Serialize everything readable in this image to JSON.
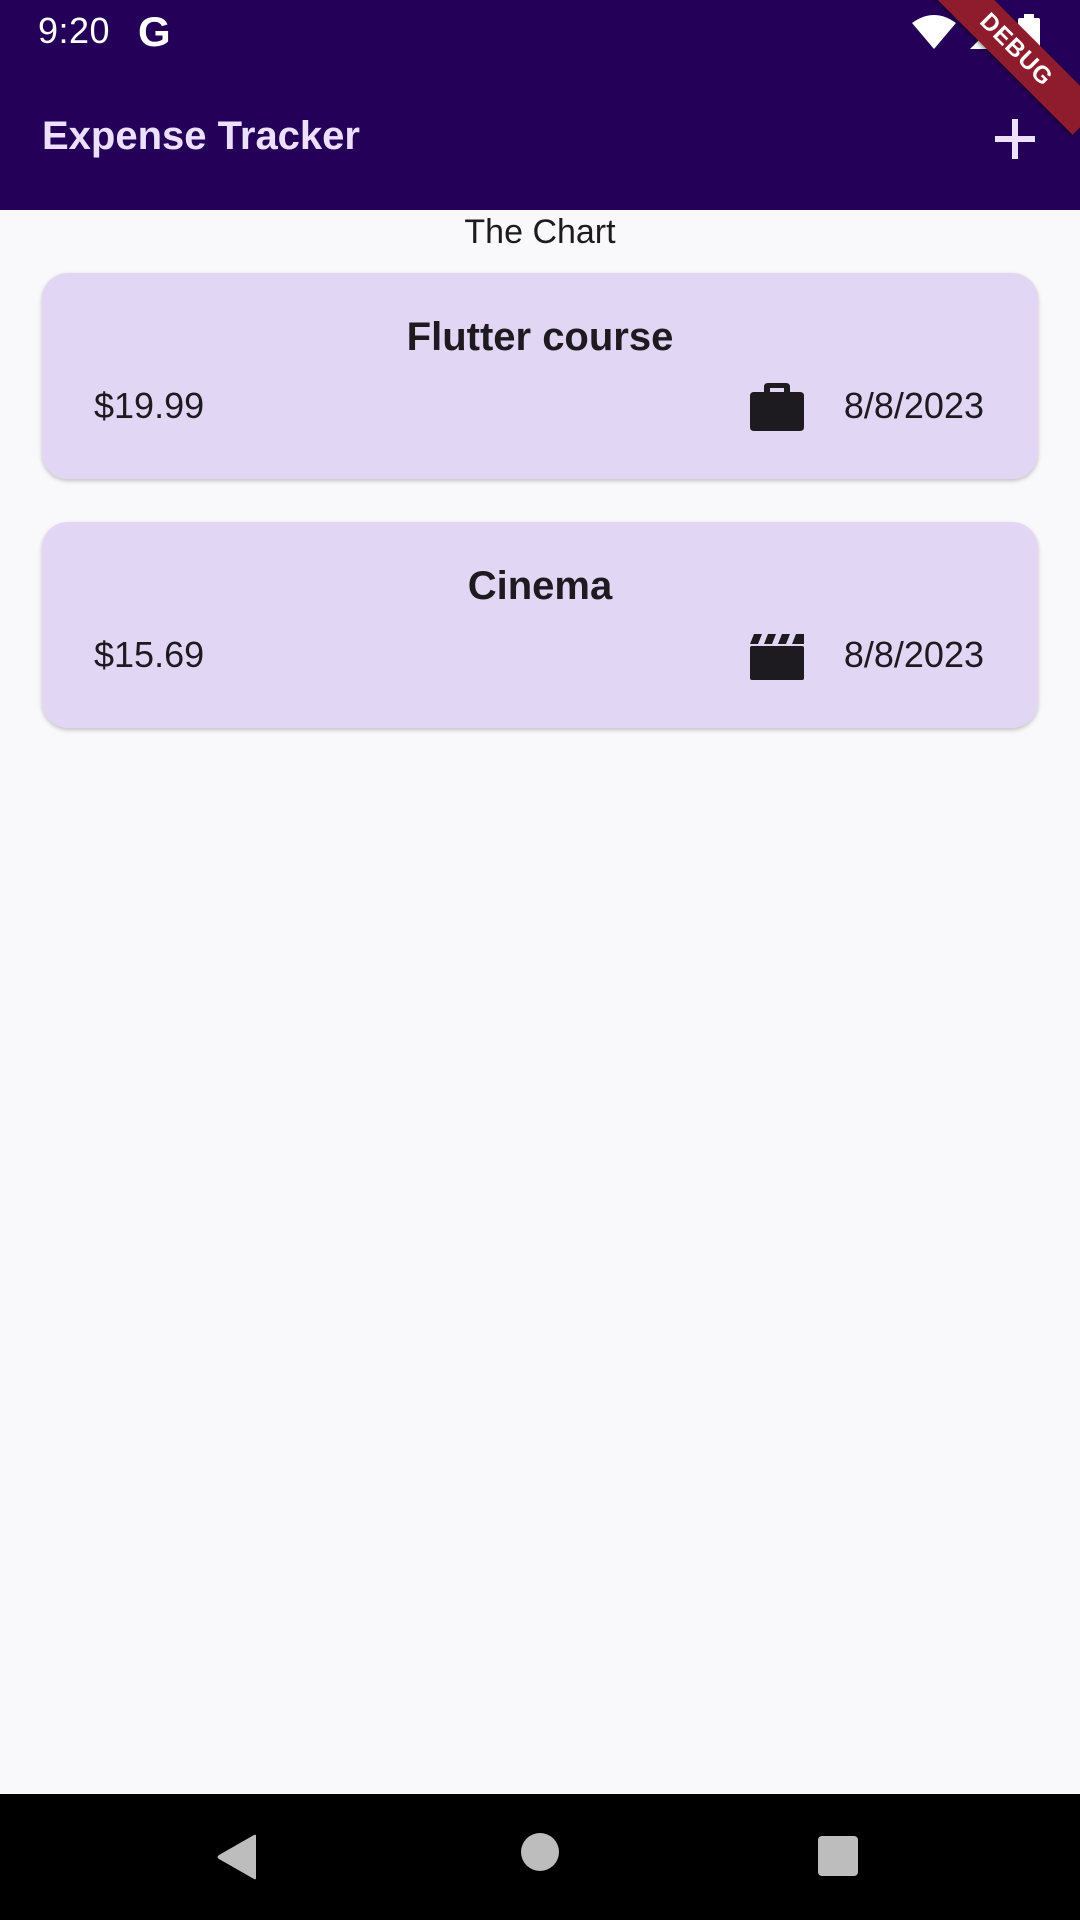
{
  "status_bar": {
    "time": "9:20",
    "google_glyph": "G",
    "icons": [
      "wifi-icon",
      "signal-icon",
      "battery-icon"
    ]
  },
  "debug_banner": "DEBUG",
  "app_bar": {
    "title": "Expense Tracker",
    "action_icon": "add-icon",
    "background": "#250059",
    "title_color": "#ece0fc"
  },
  "chart_placeholder": "The Chart",
  "expenses": [
    {
      "title": "Flutter course",
      "amount": "$19.99",
      "date": "8/8/2023",
      "category_icon": "work-briefcase-icon"
    },
    {
      "title": "Cinema",
      "amount": "$15.69",
      "date": "8/8/2023",
      "category_icon": "movie-clapper-icon"
    }
  ],
  "colors": {
    "card_background": "#e2d6f5",
    "page_background": "#f9f9fb",
    "debug_banner": "#8e1c2c"
  },
  "nav_bar": {
    "icons": [
      "back-triangle-icon",
      "home-circle-icon",
      "recents-square-icon"
    ]
  }
}
